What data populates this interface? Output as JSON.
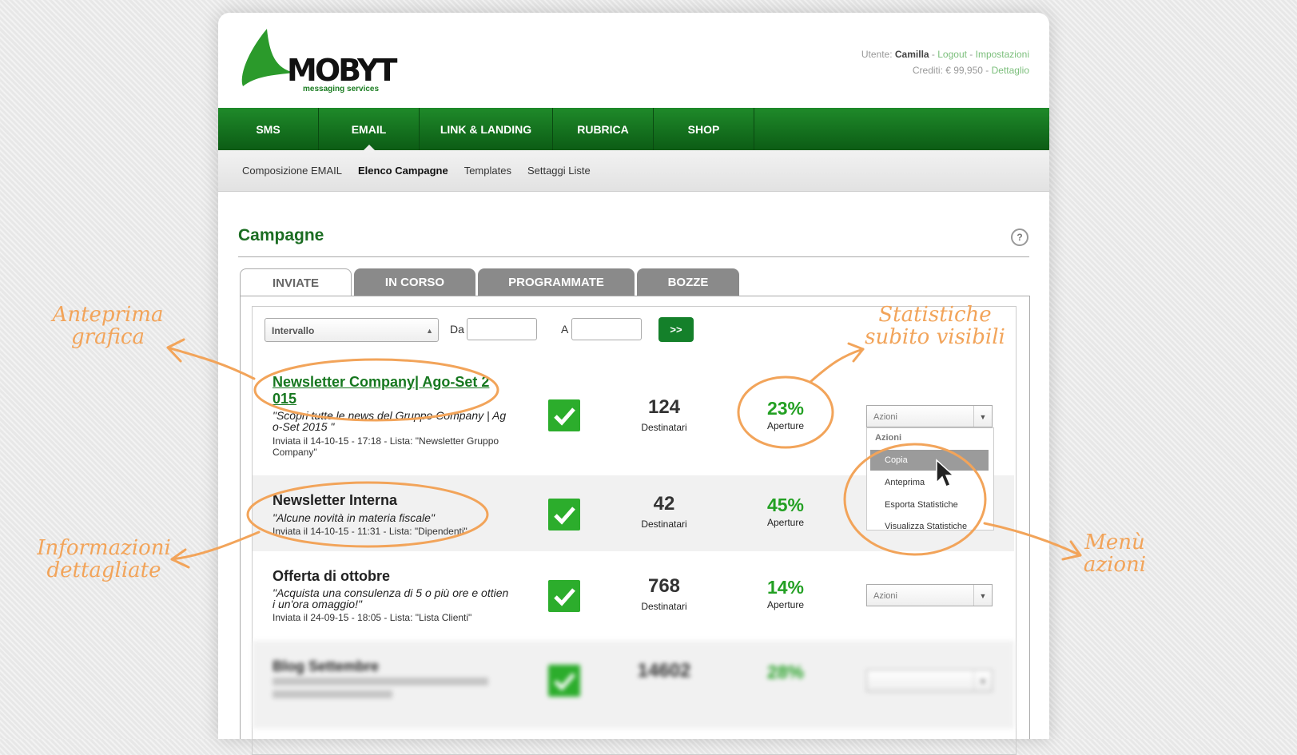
{
  "header": {
    "logo_text": "MOBYT",
    "logo_sub": "messaging services",
    "user_label": "Utente:",
    "user_name": "Camilla",
    "logout": "Logout",
    "settings": "Impostazioni",
    "credit_label": "Crediti: € 99,950",
    "detail": "Dettaglio"
  },
  "main_nav": [
    "SMS",
    "EMAIL",
    "LINK & LANDING",
    "RUBRICA",
    "SHOP"
  ],
  "sub_nav": [
    "Composizione EMAIL",
    "Elenco Campagne",
    "Templates",
    "Settaggi Liste"
  ],
  "page": {
    "title": "Campagne",
    "help": "?"
  },
  "tabs": [
    "INVIATE",
    "IN CORSO",
    "PROGRAMMATE",
    "BOZZE"
  ],
  "filter": {
    "interval": "Intervallo",
    "from_label": "Da",
    "to_label": "A",
    "go": ">>"
  },
  "campaigns": [
    {
      "title_l1": "Newsletter Company| Ago-Set 2",
      "title_l2": "015",
      "desc_l1": "\"Scopri tutte le news del Gruppo Company | Ag",
      "desc_l2": "o-Set 2015 \"",
      "meta_l1": "Inviata il 14-10-15 - 17:18 - Lista: \"Newsletter Gruppo",
      "meta_l2": "Company\"",
      "recipients": "124",
      "recipients_label": "Destinatari",
      "opens": "23%",
      "opens_label": "Aperture",
      "actions": "Azioni"
    },
    {
      "title": "Newsletter Interna",
      "desc": "\"Alcune novità in materia fiscale\"",
      "meta": "Inviata il 14-10-15 - 11:31 - Lista: \"Dipendenti\"",
      "recipients": "42",
      "recipients_label": "Destinatari",
      "opens": "45%",
      "opens_label": "Aperture"
    },
    {
      "title": "Offerta di ottobre",
      "desc_l1": "\"Acquista una consulenza di 5 o più ore e ottien",
      "desc_l2": "i un'ora omaggio!\"",
      "meta": "Inviata il 24-09-15 - 18:05 - Lista: \"Lista Clienti\"",
      "recipients": "768",
      "recipients_label": "Destinatari",
      "opens": "14%",
      "opens_label": "Aperture",
      "actions": "Azioni"
    },
    {
      "title": "Blog Settembre",
      "recipients": "14602",
      "opens": "28%"
    }
  ],
  "actions_menu": {
    "header": "Azioni",
    "items": [
      "Copia",
      "Anteprima",
      "Esporta Statistiche",
      "Visualizza Statistiche"
    ]
  },
  "annotations": {
    "a1": "Anteprima grafica",
    "a2": "Informazioni dettagliate",
    "a3": "Statistiche subito visibili",
    "a4": "Menù azioni"
  },
  "colors": {
    "brand_green": "#14802a",
    "stat_green": "#23a023",
    "annotation": "#f2a45a"
  }
}
